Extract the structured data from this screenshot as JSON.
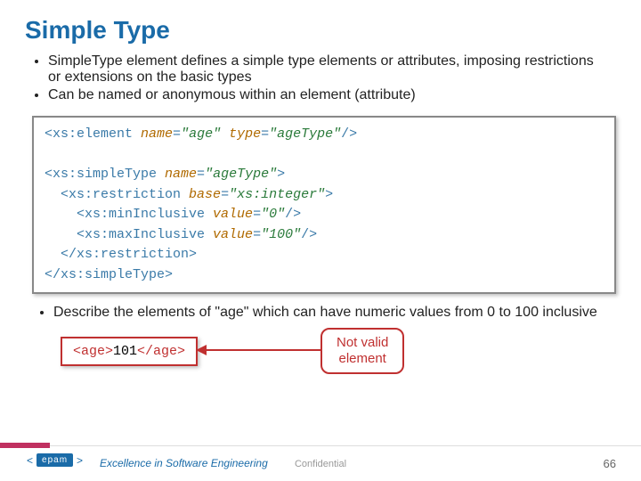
{
  "title": "Simple Type",
  "bullets": [
    "SimpleType element defines a simple type elements or attributes, imposing restrictions or extensions on the basic types",
    "Can be named or anonymous within an element (attribute)"
  ],
  "code": {
    "l1": {
      "open": "<xs:element",
      "a1n": " name",
      "a1v": "\"age\"",
      "a2n": " type",
      "a2v": "\"ageType\"",
      "close": "/>"
    },
    "l2": {
      "open": "<xs:simpleType",
      "a1n": " name",
      "a1v": "\"ageType\"",
      "close": ">"
    },
    "l3": {
      "open": "<xs:restriction",
      "a1n": " base",
      "a1v": "\"xs:integer\"",
      "close": ">"
    },
    "l4": {
      "open": "<xs:minInclusive",
      "a1n": " value",
      "a1v": "\"0\"",
      "close": "/>"
    },
    "l5": {
      "open": "<xs:maxInclusive",
      "a1n": " value",
      "a1v": "\"100\"",
      "close": "/>"
    },
    "l6": "</xs:restriction>",
    "l7": "</xs:simpleType>"
  },
  "bullets2": [
    "Describe the elements of \"age\" which can have numeric values from 0 to 100 inclusive"
  ],
  "example": {
    "open": "<age>",
    "val": "101",
    "close": "</age>"
  },
  "callout": {
    "l1": "Not valid",
    "l2": "element"
  },
  "footer": {
    "logo_text": "epam",
    "tagline": "Excellence in Software Engineering",
    "confidential": "Confidential",
    "page": "66"
  }
}
